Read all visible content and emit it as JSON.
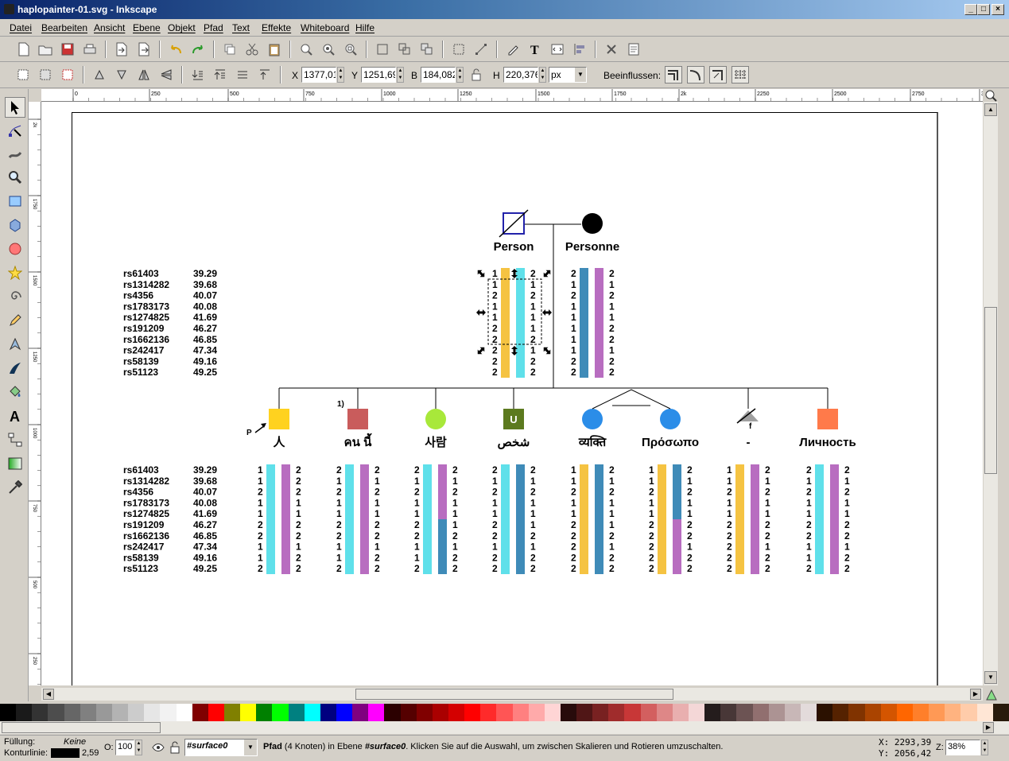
{
  "window": {
    "title": "haplopainter-01.svg - Inkscape"
  },
  "menu": [
    "Datei",
    "Bearbeiten",
    "Ansicht",
    "Ebene",
    "Objekt",
    "Pfad",
    "Text",
    "Effekte",
    "Whiteboard",
    "Hilfe"
  ],
  "coords": {
    "x_label": "X",
    "x": "1377,01",
    "y_label": "Y",
    "y": "1251,69",
    "w_label": "B",
    "w": "184,082",
    "h_label": "H",
    "h": "220,376",
    "unit": "px",
    "affect_label": "Beeinflussen:"
  },
  "ruler_h": [
    "0",
    "250",
    "500",
    "750",
    "1000",
    "1250",
    "1500",
    "1750",
    "2k",
    "2250",
    "2500",
    "2750",
    "3"
  ],
  "ruler_v": [
    "2k",
    "1750",
    "1500",
    "1250",
    "1000",
    "750",
    "500",
    "250"
  ],
  "pedigree": {
    "parents": [
      {
        "name": "Person",
        "shape": "square",
        "deceased": true
      },
      {
        "name": "Personne",
        "shape": "circle",
        "color": "#000000"
      }
    ],
    "markers": [
      "rs61403",
      "rs1314282",
      "rs4356",
      "rs1783173",
      "rs1274825",
      "rs191209",
      "rs1662136",
      "rs242417",
      "rs58139",
      "rs51123"
    ],
    "positions": [
      "39.29",
      "39.68",
      "40.07",
      "40.08",
      "41.69",
      "46.27",
      "46.85",
      "47.34",
      "49.16",
      "49.25"
    ],
    "father_hap": {
      "left": [
        "1",
        "1",
        "2",
        "1",
        "1",
        "2",
        "2",
        "2",
        "2",
        "2"
      ],
      "right": [
        "2",
        "1",
        "2",
        "1",
        "1",
        "1",
        "2",
        "1",
        "2",
        "2"
      ],
      "colors": [
        "#f5c342",
        "#5fe0ea"
      ]
    },
    "mother_hap": {
      "left": [
        "2",
        "1",
        "2",
        "1",
        "1",
        "1",
        "1",
        "1",
        "2",
        "2"
      ],
      "right": [
        "2",
        "1",
        "2",
        "1",
        "1",
        "2",
        "2",
        "1",
        "2",
        "2"
      ],
      "colors": [
        "#3f8bb8",
        "#b86dc0"
      ]
    },
    "children": [
      {
        "name": "人",
        "shape": "square",
        "color": "#ffd21f",
        "proband_label": "P",
        "left": [
          "1",
          "1",
          "2",
          "1",
          "1",
          "2",
          "2",
          "1",
          "1",
          "2"
        ],
        "right": [
          "2",
          "2",
          "2",
          "1",
          "1",
          "2",
          "2",
          "1",
          "2",
          "2"
        ],
        "c1": "#5fe0ea",
        "c2": "#b86dc0"
      },
      {
        "name": "คน นี้",
        "shape": "square",
        "color": "#c95c5c",
        "note": "1)",
        "left": [
          "2",
          "1",
          "2",
          "1",
          "1",
          "2",
          "2",
          "1",
          "1",
          "2"
        ],
        "right": [
          "2",
          "1",
          "2",
          "1",
          "1",
          "2",
          "2",
          "1",
          "2",
          "2"
        ],
        "c1": "#5fe0ea",
        "c2": "#b86dc0"
      },
      {
        "name": "사람",
        "shape": "circle",
        "color": "#a8e83a",
        "left": [
          "2",
          "1",
          "2",
          "1",
          "1",
          "2",
          "2",
          "1",
          "1",
          "2"
        ],
        "right": [
          "2",
          "1",
          "2",
          "1",
          "1",
          "1",
          "2",
          "1",
          "2",
          "2"
        ],
        "c1": "#5fe0ea",
        "c2": "#b86dc0",
        "c2b": "#3f8bb8"
      },
      {
        "name": "شخص",
        "shape": "square",
        "color": "#5c7a1f",
        "label_inside": "U",
        "left": [
          "2",
          "1",
          "2",
          "1",
          "1",
          "2",
          "2",
          "1",
          "2",
          "2"
        ],
        "right": [
          "2",
          "1",
          "2",
          "1",
          "1",
          "1",
          "2",
          "1",
          "2",
          "2"
        ],
        "c1": "#5fe0ea",
        "c2": "#3f8bb8"
      },
      {
        "name": "व्यक्ति",
        "shape": "circle",
        "color": "#2b8de8",
        "left": [
          "1",
          "1",
          "2",
          "1",
          "1",
          "2",
          "2",
          "2",
          "2",
          "2"
        ],
        "right": [
          "2",
          "1",
          "2",
          "1",
          "1",
          "1",
          "2",
          "1",
          "2",
          "2"
        ],
        "c1": "#f5c342",
        "c2": "#3f8bb8"
      },
      {
        "name": "Πρόσωπο",
        "shape": "circle",
        "color": "#2b8de8",
        "left": [
          "1",
          "1",
          "2",
          "1",
          "1",
          "2",
          "2",
          "2",
          "2",
          "2"
        ],
        "right": [
          "2",
          "1",
          "2",
          "1",
          "1",
          "2",
          "2",
          "1",
          "2",
          "2"
        ],
        "c1": "#f5c342",
        "c2": "#3f8bb8",
        "c2b": "#b86dc0"
      },
      {
        "name": "-",
        "shape": "triangle",
        "color": "#a0a0a0",
        "note": "f",
        "left": [
          "1",
          "1",
          "2",
          "1",
          "1",
          "2",
          "2",
          "2",
          "2",
          "2"
        ],
        "right": [
          "2",
          "1",
          "2",
          "1",
          "1",
          "2",
          "2",
          "1",
          "2",
          "2"
        ],
        "c1": "#f5c342",
        "c2": "#b86dc0"
      },
      {
        "name": "Личность",
        "shape": "square",
        "color": "#ff7a4a",
        "left": [
          "2",
          "1",
          "2",
          "1",
          "1",
          "2",
          "2",
          "1",
          "1",
          "2"
        ],
        "right": [
          "2",
          "1",
          "2",
          "1",
          "1",
          "2",
          "2",
          "1",
          "2",
          "2"
        ],
        "c1": "#5fe0ea",
        "c2": "#b86dc0"
      }
    ]
  },
  "palette": [
    "#000000",
    "#1a1a1a",
    "#333333",
    "#4d4d4d",
    "#666666",
    "#808080",
    "#999999",
    "#b3b3b3",
    "#cccccc",
    "#e6e6e6",
    "#f2f2f2",
    "#ffffff",
    "#800000",
    "#ff0000",
    "#808000",
    "#ffff00",
    "#008000",
    "#00ff00",
    "#008080",
    "#00ffff",
    "#000080",
    "#0000ff",
    "#800080",
    "#ff00ff",
    "#2b0000",
    "#550000",
    "#800000",
    "#aa0000",
    "#d40000",
    "#ff0000",
    "#ff2a2a",
    "#ff5555",
    "#ff8080",
    "#ffaaaa",
    "#ffd5d5",
    "#280b0b",
    "#501616",
    "#782121",
    "#a02c2c",
    "#c83737",
    "#d35f5f",
    "#de8787",
    "#e9afaf",
    "#f4d7d7",
    "#241c1c",
    "#483737",
    "#6c5353",
    "#916f6f",
    "#ac9393",
    "#c8b7b7",
    "#e3dbdb",
    "#2b1100",
    "#552200",
    "#803300",
    "#aa4400",
    "#d45500",
    "#ff6600",
    "#ff7f2a",
    "#ff9955",
    "#ffb380",
    "#ffccaa",
    "#ffe6d5",
    "#281a0b"
  ],
  "status": {
    "fill_label": "Füllung:",
    "fill_value": "Keine",
    "stroke_label": "Konturlinie:",
    "stroke_width": "2,59",
    "opacity_label": "O:",
    "opacity": "100",
    "layer": "#surface0",
    "message_bold": "Pfad",
    "message_1": " (4 Knoten) in Ebene ",
    "message_layer": "#surface0",
    "message_2": ". Klicken Sie auf die Auswahl, um zwischen Skalieren und Rotieren umzuschalten.",
    "cursor_x": "X: 2293,39",
    "cursor_y": "Y: 2056,42",
    "zoom_label": "Z:",
    "zoom": "38%"
  }
}
